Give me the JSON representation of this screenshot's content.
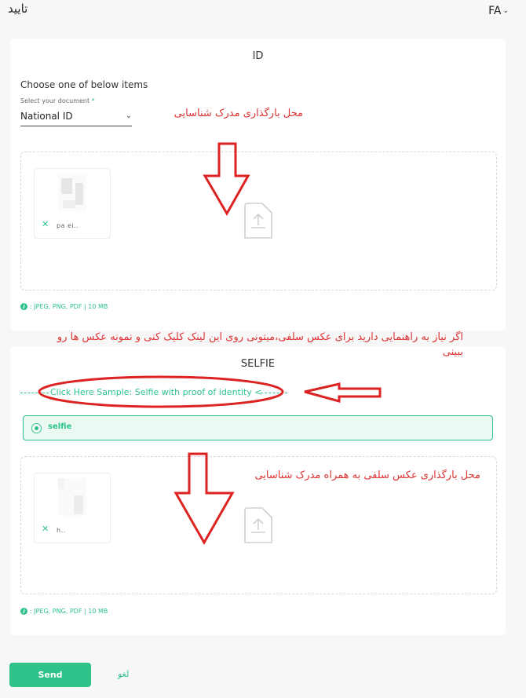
{
  "header": {
    "title": "تایید",
    "lang": "FA"
  },
  "id_section": {
    "title": "ID",
    "choose_text": "Choose one of below items",
    "select_label": "Select your document",
    "required_mark": "*",
    "select_value": "National ID",
    "file_name": "pa      ei..",
    "hint": ": JPEG, PNG, PDF | 10 MB"
  },
  "selfie_section": {
    "title": "SELFIE",
    "sample_link": "Click Here Sample: Selfie with proof of identity <",
    "option_label": "selfie",
    "file_name": "        h..",
    "hint": ": JPEG, PNG, PDF | 10 MB"
  },
  "annotations": {
    "id_upload": "محل بارگذاری مدرک شناسایی",
    "guide": "اگر نیاز به راهنمایی دارید برای عکس سلفی،میتونی روی این لینک کلیک کنی و نمونه عکس ها رو ببینی",
    "selfie_upload": "محل بارگذاری عکس سلفی به همراه مدرک شناسایی"
  },
  "footer": {
    "send_label": "Send",
    "cancel_label": "لغو"
  },
  "colors": {
    "accent": "#2ec28a",
    "annotation": "#dd2222"
  },
  "icons": [
    "chevron-down-icon",
    "upload-icon",
    "info-icon",
    "close-icon",
    "radio-icon"
  ]
}
